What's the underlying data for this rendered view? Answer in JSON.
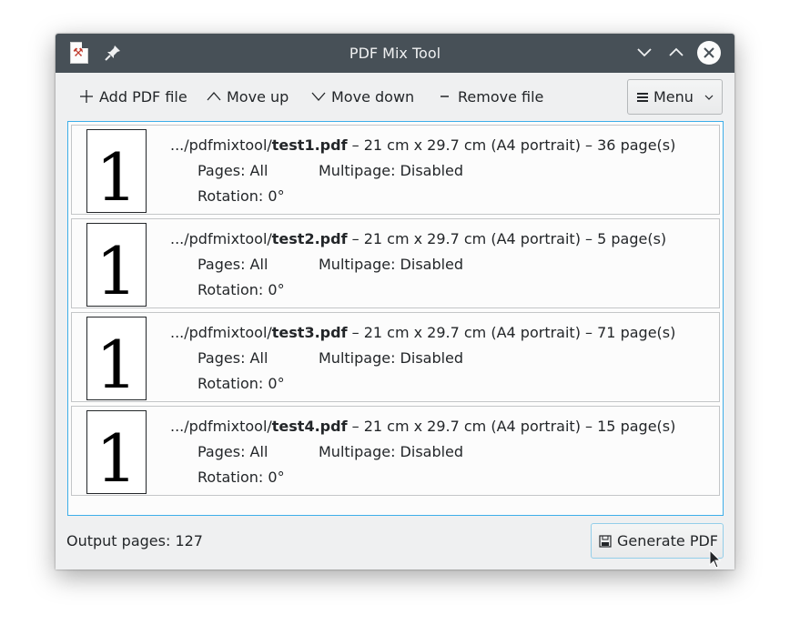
{
  "window": {
    "title": "PDF Mix Tool"
  },
  "toolbar": {
    "add_label": "Add PDF file",
    "move_up_label": "Move up",
    "move_down_label": "Move down",
    "remove_label": "Remove file",
    "menu_label": "Menu"
  },
  "files": [
    {
      "path_prefix": ".../pdfmixtool/",
      "name": "test1.pdf",
      "details": "21 cm x 29.7 cm (A4 portrait)",
      "pages_count": "36 page(s)",
      "thumb": "1",
      "pages": "Pages: All",
      "multipage": "Multipage: Disabled",
      "rotation": "Rotation: 0°"
    },
    {
      "path_prefix": ".../pdfmixtool/",
      "name": "test2.pdf",
      "details": "21 cm x 29.7 cm (A4 portrait)",
      "pages_count": "5 page(s)",
      "thumb": "1",
      "pages": "Pages: All",
      "multipage": "Multipage: Disabled",
      "rotation": "Rotation: 0°"
    },
    {
      "path_prefix": ".../pdfmixtool/",
      "name": "test3.pdf",
      "details": "21 cm x 29.7 cm (A4 portrait)",
      "pages_count": "71 page(s)",
      "thumb": "1",
      "pages": "Pages: All",
      "multipage": "Multipage: Disabled",
      "rotation": "Rotation: 0°"
    },
    {
      "path_prefix": ".../pdfmixtool/",
      "name": "test4.pdf",
      "details": "21 cm x 29.7 cm (A4 portrait)",
      "pages_count": "15 page(s)",
      "thumb": "1",
      "pages": "Pages: All",
      "multipage": "Multipage: Disabled",
      "rotation": "Rotation: 0°"
    }
  ],
  "separator": " – ",
  "footer": {
    "output_pages": "Output pages: 127",
    "generate_label": "Generate PDF"
  },
  "icons": {
    "app": "pdf-mix-tool-icon",
    "pin": "pin-icon",
    "minimize": "chevron-down-icon",
    "maximize": "chevron-up-icon",
    "close": "close-icon",
    "add": "plus-icon",
    "move_up": "chevron-up-icon",
    "move_down": "chevron-down-icon",
    "remove": "minus-icon",
    "menu": "hamburger-icon",
    "generate": "save-icon"
  },
  "colors": {
    "titlebar": "#475057",
    "window_bg": "#eff0f1",
    "accent": "#3daee9",
    "text": "#232629"
  }
}
